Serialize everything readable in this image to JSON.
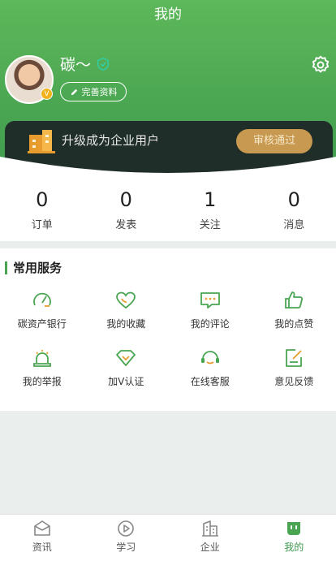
{
  "header": {
    "title": "我的",
    "username": "碳～",
    "avatar_badge": "V",
    "profile_button_label": "完善资料"
  },
  "upgrade": {
    "text": "升级成为企业用户",
    "button_label": "审核通过"
  },
  "stats": [
    {
      "value": "0",
      "label": "订单"
    },
    {
      "value": "0",
      "label": "发表"
    },
    {
      "value": "1",
      "label": "关注"
    },
    {
      "value": "0",
      "label": "消息"
    }
  ],
  "services": {
    "title": "常用服务",
    "items": [
      {
        "label": "碳资产银行",
        "icon": "gauge-icon"
      },
      {
        "label": "我的收藏",
        "icon": "heart-icon"
      },
      {
        "label": "我的评论",
        "icon": "comment-icon"
      },
      {
        "label": "我的点赞",
        "icon": "thumbs-up-icon"
      },
      {
        "label": "我的举报",
        "icon": "alarm-icon"
      },
      {
        "label": "加V认证",
        "icon": "diamond-icon"
      },
      {
        "label": "在线客服",
        "icon": "headset-icon"
      },
      {
        "label": "意见反馈",
        "icon": "feedback-icon"
      }
    ]
  },
  "tabbar": {
    "active": "我的",
    "items": [
      {
        "label": "资讯",
        "icon": "news-icon"
      },
      {
        "label": "学习",
        "icon": "play-icon"
      },
      {
        "label": "企业",
        "icon": "building-icon"
      },
      {
        "label": "我的",
        "icon": "profile-icon"
      }
    ]
  },
  "colors": {
    "primary": "#4aa552",
    "card_dark": "#1f2e28",
    "audit_gold": "#c89950"
  }
}
